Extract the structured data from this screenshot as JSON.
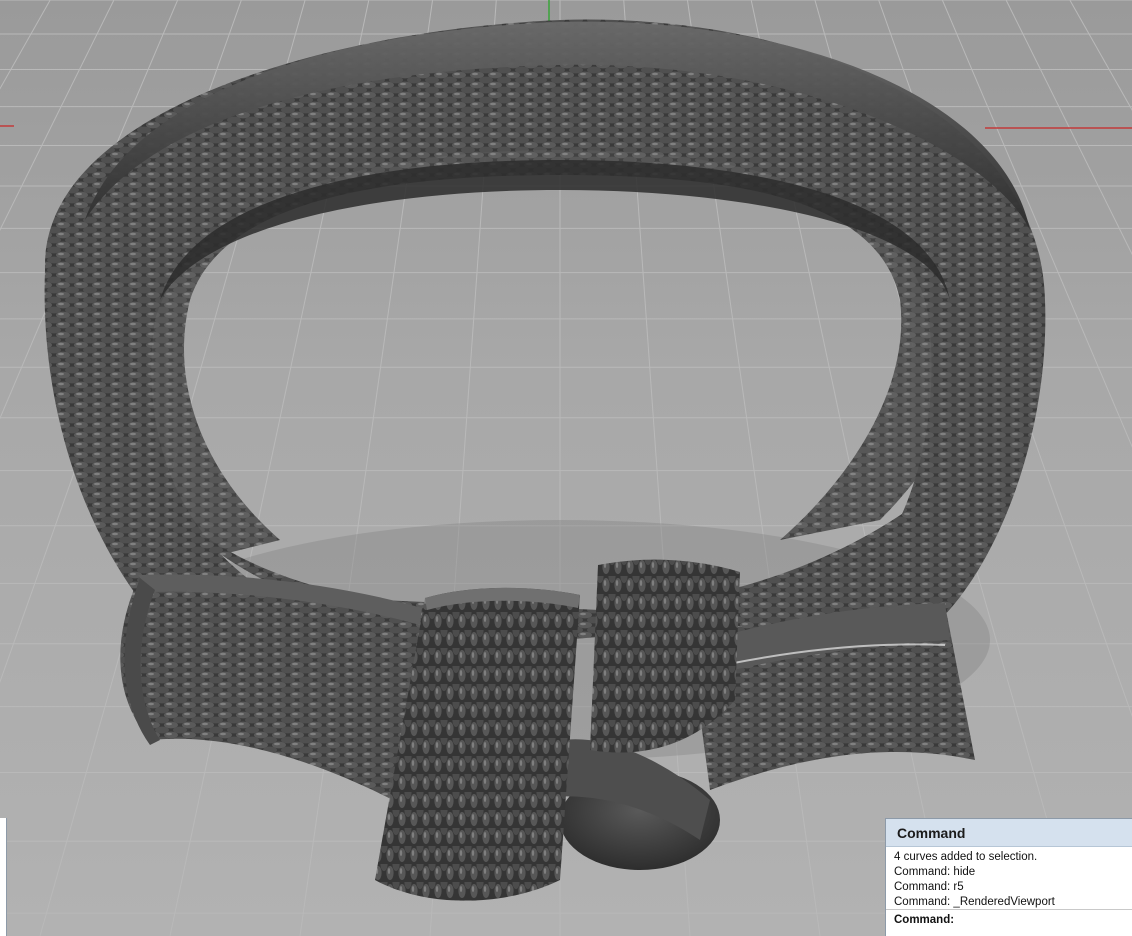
{
  "viewport": {
    "name": "Rendered Viewport",
    "model": "textured knot ring"
  },
  "command_panel": {
    "title": "Command",
    "history": [
      "4 curves added to selection.",
      "Command: hide",
      "Command: r5",
      "Command: _RenderedViewport"
    ],
    "prompt": "Command:"
  },
  "colors": {
    "grid_line": "#b9b9b9",
    "x_axis": "#c23a3a",
    "y_axis": "#3aa53a",
    "ring_body": "#3d3d3d",
    "panel_header": "#d5e1ee"
  }
}
